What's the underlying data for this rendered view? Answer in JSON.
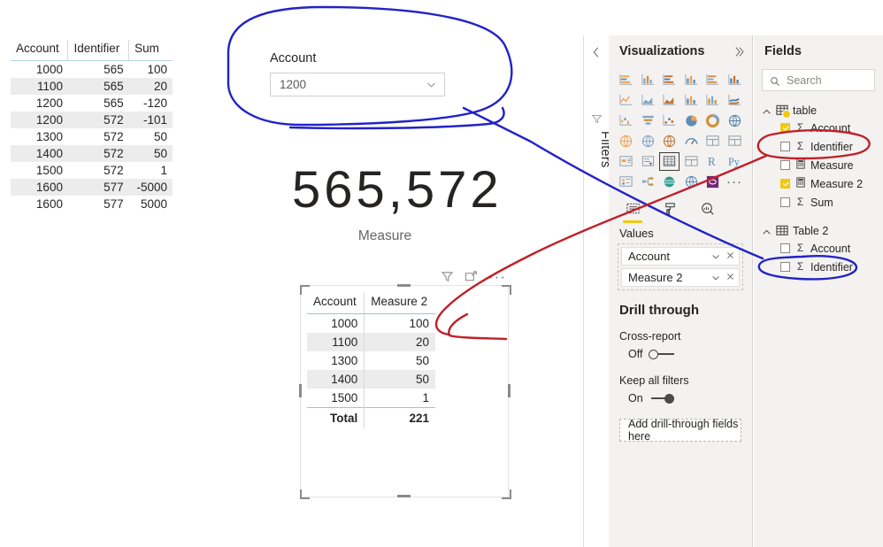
{
  "source_table": {
    "columns": [
      "Account",
      "Identifier",
      "Sum"
    ],
    "rows": [
      [
        "1000",
        "565",
        "100"
      ],
      [
        "1100",
        "565",
        "20"
      ],
      [
        "1200",
        "565",
        "-120"
      ],
      [
        "1200",
        "572",
        "-101"
      ],
      [
        "1300",
        "572",
        "50"
      ],
      [
        "1400",
        "572",
        "50"
      ],
      [
        "1500",
        "572",
        "1"
      ],
      [
        "1600",
        "577",
        "-5000"
      ],
      [
        "1600",
        "577",
        "5000"
      ]
    ]
  },
  "slicer": {
    "title": "Account",
    "selected_value": "1200",
    "chevron_icon": "chevron-down-icon"
  },
  "card": {
    "value": "565,572",
    "label": "Measure"
  },
  "visual_header": {
    "filter_icon": "filter-icon",
    "focus_icon": "focus-mode-icon",
    "more_label": "···"
  },
  "visual_table": {
    "columns": [
      "Account",
      "Measure 2"
    ],
    "rows": [
      [
        "1000",
        "100"
      ],
      [
        "1100",
        "20"
      ],
      [
        "1300",
        "50"
      ],
      [
        "1400",
        "50"
      ],
      [
        "1500",
        "1"
      ]
    ],
    "total_label": "Total",
    "total_value": "221"
  },
  "filters_rail": {
    "collapse_icon": "chevron-left-icon",
    "funnel_icon": "filter-icon",
    "label": "Filters"
  },
  "visualizations": {
    "title": "Visualizations",
    "expand_icon": "chevron-right-icon",
    "gallery": [
      "stacked-bar-chart-icon",
      "stacked-column-chart-icon",
      "clustered-bar-chart-icon",
      "clustered-column-chart-icon",
      "hundred-percent-stacked-bar-chart-icon",
      "hundred-percent-stacked-column-chart-icon",
      "line-chart-icon",
      "area-chart-icon",
      "stacked-area-chart-icon",
      "line-stacked-column-chart-icon",
      "line-clustered-column-chart-icon",
      "ribbon-chart-icon",
      "waterfall-chart-icon",
      "funnel-chart-icon",
      "scatter-chart-icon",
      "pie-chart-icon",
      "donut-chart-icon",
      "treemap-icon",
      "map-icon",
      "filled-map-icon",
      "shape-map-icon",
      "gauge-icon",
      "card-icon",
      "multi-row-card-icon",
      "kpi-icon",
      "slicer-icon",
      "table-icon",
      "matrix-icon",
      "r-script-visual-icon",
      "python-visual-icon",
      "key-influencers-icon",
      "decomposition-tree-icon",
      "q-and-a-icon",
      "arcgis-maps-icon",
      "power-apps-icon",
      "more-visuals-icon"
    ],
    "selected_visual": "table-icon",
    "tabs": [
      {
        "name": "fields-tab",
        "icon": "fields-well-icon",
        "active": true
      },
      {
        "name": "format-tab",
        "icon": "paint-roller-icon",
        "active": false
      },
      {
        "name": "analytics-tab",
        "icon": "magnifier-chart-icon",
        "active": false
      }
    ],
    "values_well": {
      "title": "Values",
      "items": [
        {
          "label": "Account",
          "chevron_icon": "chevron-down-icon",
          "remove_icon": "close-icon"
        },
        {
          "label": "Measure 2",
          "chevron_icon": "chevron-down-icon",
          "remove_icon": "close-icon"
        }
      ]
    },
    "drill_through": {
      "title": "Drill through",
      "cross_report_label": "Cross-report",
      "cross_report_state": "Off",
      "keep_all_filters_label": "Keep all filters",
      "keep_all_filters_state": "On",
      "drop_zone_label": "Add drill-through fields here"
    }
  },
  "fields": {
    "title": "Fields",
    "expand_icon": "chevron-right-icon",
    "search_placeholder": "Search",
    "search_icon": "search-icon",
    "tables": [
      {
        "name": "table",
        "table_icon": "table-icon",
        "chevron_icon": "chevron-up-icon",
        "has_badge": true,
        "fields": [
          {
            "label": "Account",
            "checked": true,
            "type_icon": "sigma-icon"
          },
          {
            "label": "Identifier",
            "checked": false,
            "type_icon": "sigma-icon"
          },
          {
            "label": "Measure",
            "checked": false,
            "type_icon": "calculator-icon"
          },
          {
            "label": "Measure 2",
            "checked": true,
            "type_icon": "calculator-icon"
          },
          {
            "label": "Sum",
            "checked": false,
            "type_icon": "sigma-icon"
          }
        ]
      },
      {
        "name": "Table 2",
        "table_icon": "table-icon",
        "chevron_icon": "chevron-up-icon",
        "has_badge": false,
        "fields": [
          {
            "label": "Account",
            "checked": false,
            "type_icon": "sigma-icon"
          },
          {
            "label": "Identifier",
            "checked": false,
            "type_icon": "sigma-icon"
          }
        ]
      }
    ]
  },
  "annotations": {
    "blue_color": "#2222c8",
    "red_color": "#c0202a",
    "shapes": [
      {
        "name": "blue-ellipse-around-slicer"
      },
      {
        "name": "blue-line-to-table2-account"
      },
      {
        "name": "blue-ellipse-around-table2-account"
      },
      {
        "name": "red-ellipse-around-table-account"
      },
      {
        "name": "red-arrow-to-visual-table"
      }
    ]
  }
}
